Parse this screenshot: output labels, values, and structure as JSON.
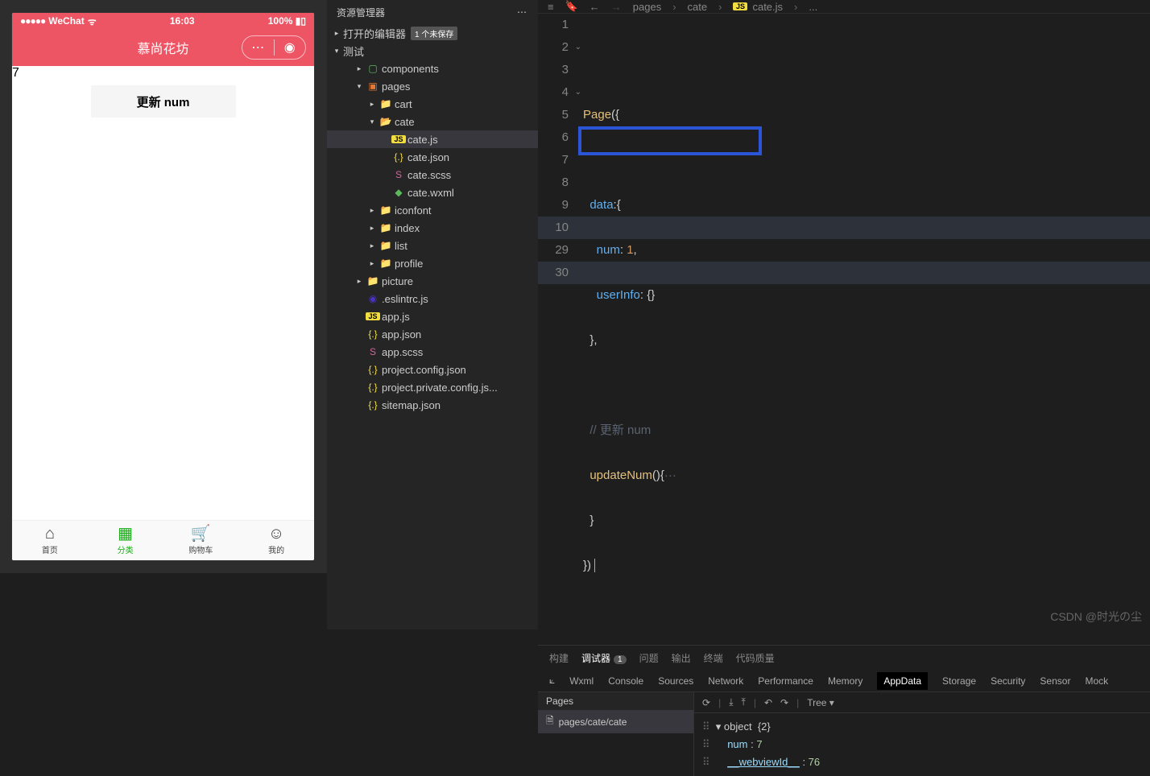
{
  "simulator": {
    "carrier": "WeChat",
    "time": "16:03",
    "battery": "100%",
    "appTitle": "慕尚花坊",
    "displayedNum": "7",
    "updateBtn": "更新 num",
    "tabs": [
      {
        "label": "首页",
        "icon": "⌂"
      },
      {
        "label": "分类",
        "icon": "▦"
      },
      {
        "label": "购物车",
        "icon": "🛒"
      },
      {
        "label": "我的",
        "icon": "☺"
      }
    ],
    "activeTab": 1
  },
  "explorer": {
    "title": "资源管理器",
    "openEditors": "打开的编辑器",
    "unsavedBadge": "1 个未保存",
    "testLabel": "测试",
    "tree": [
      {
        "d": 2,
        "chev": "▸",
        "icon": "comp",
        "label": "components"
      },
      {
        "d": 2,
        "chev": "▾",
        "icon": "pages",
        "label": "pages"
      },
      {
        "d": 3,
        "chev": "▸",
        "icon": "folder",
        "label": "cart"
      },
      {
        "d": 3,
        "chev": "▾",
        "icon": "folder-open",
        "label": "cate"
      },
      {
        "d": 4,
        "chev": "",
        "icon": "js",
        "label": "cate.js",
        "active": true
      },
      {
        "d": 4,
        "chev": "",
        "icon": "json",
        "label": "cate.json"
      },
      {
        "d": 4,
        "chev": "",
        "icon": "scss",
        "label": "cate.scss"
      },
      {
        "d": 4,
        "chev": "",
        "icon": "wxml",
        "label": "cate.wxml"
      },
      {
        "d": 3,
        "chev": "▸",
        "icon": "folder",
        "label": "iconfont"
      },
      {
        "d": 3,
        "chev": "▸",
        "icon": "folder",
        "label": "index"
      },
      {
        "d": 3,
        "chev": "▸",
        "icon": "folder",
        "label": "list"
      },
      {
        "d": 3,
        "chev": "▸",
        "icon": "folder",
        "label": "profile"
      },
      {
        "d": 2,
        "chev": "▸",
        "icon": "folder",
        "label": "picture"
      },
      {
        "d": 2,
        "chev": "",
        "icon": "eslint",
        "label": ".eslintrc.js"
      },
      {
        "d": 2,
        "chev": "",
        "icon": "js",
        "label": "app.js"
      },
      {
        "d": 2,
        "chev": "",
        "icon": "json",
        "label": "app.json"
      },
      {
        "d": 2,
        "chev": "",
        "icon": "scss",
        "label": "app.scss"
      },
      {
        "d": 2,
        "chev": "",
        "icon": "json",
        "label": "project.config.json"
      },
      {
        "d": 2,
        "chev": "",
        "icon": "json",
        "label": "project.private.config.js..."
      },
      {
        "d": 2,
        "chev": "",
        "icon": "json",
        "label": "sitemap.json"
      }
    ]
  },
  "breadcrumb": {
    "path1": "pages",
    "path2": "cate",
    "file": "cate.js",
    "trail": "..."
  },
  "code": {
    "lines": [
      "1",
      "2",
      "3",
      "4",
      "5",
      "6",
      "7",
      "8",
      "9",
      "10",
      "29",
      "30"
    ]
  },
  "bottomTabs": {
    "build": "构建",
    "debugger": "调试器",
    "badge": "1",
    "problems": "问题",
    "output": "输出",
    "terminal": "终端",
    "quality": "代码质量"
  },
  "devTabs": [
    "Wxml",
    "Console",
    "Sources",
    "Network",
    "Performance",
    "Memory",
    "AppData",
    "Storage",
    "Security",
    "Sensor",
    "Mock"
  ],
  "devActive": 6,
  "pagesPanel": {
    "header": "Pages",
    "active": "pages/cate/cate"
  },
  "appData": {
    "toolbar": {
      "mode": "Tree"
    },
    "root": "object",
    "count": "{2}",
    "rows": [
      {
        "key": "num",
        "val": "7"
      },
      {
        "key": "__webviewId__",
        "val": "76"
      }
    ]
  },
  "watermark": "CSDN @时光の尘"
}
